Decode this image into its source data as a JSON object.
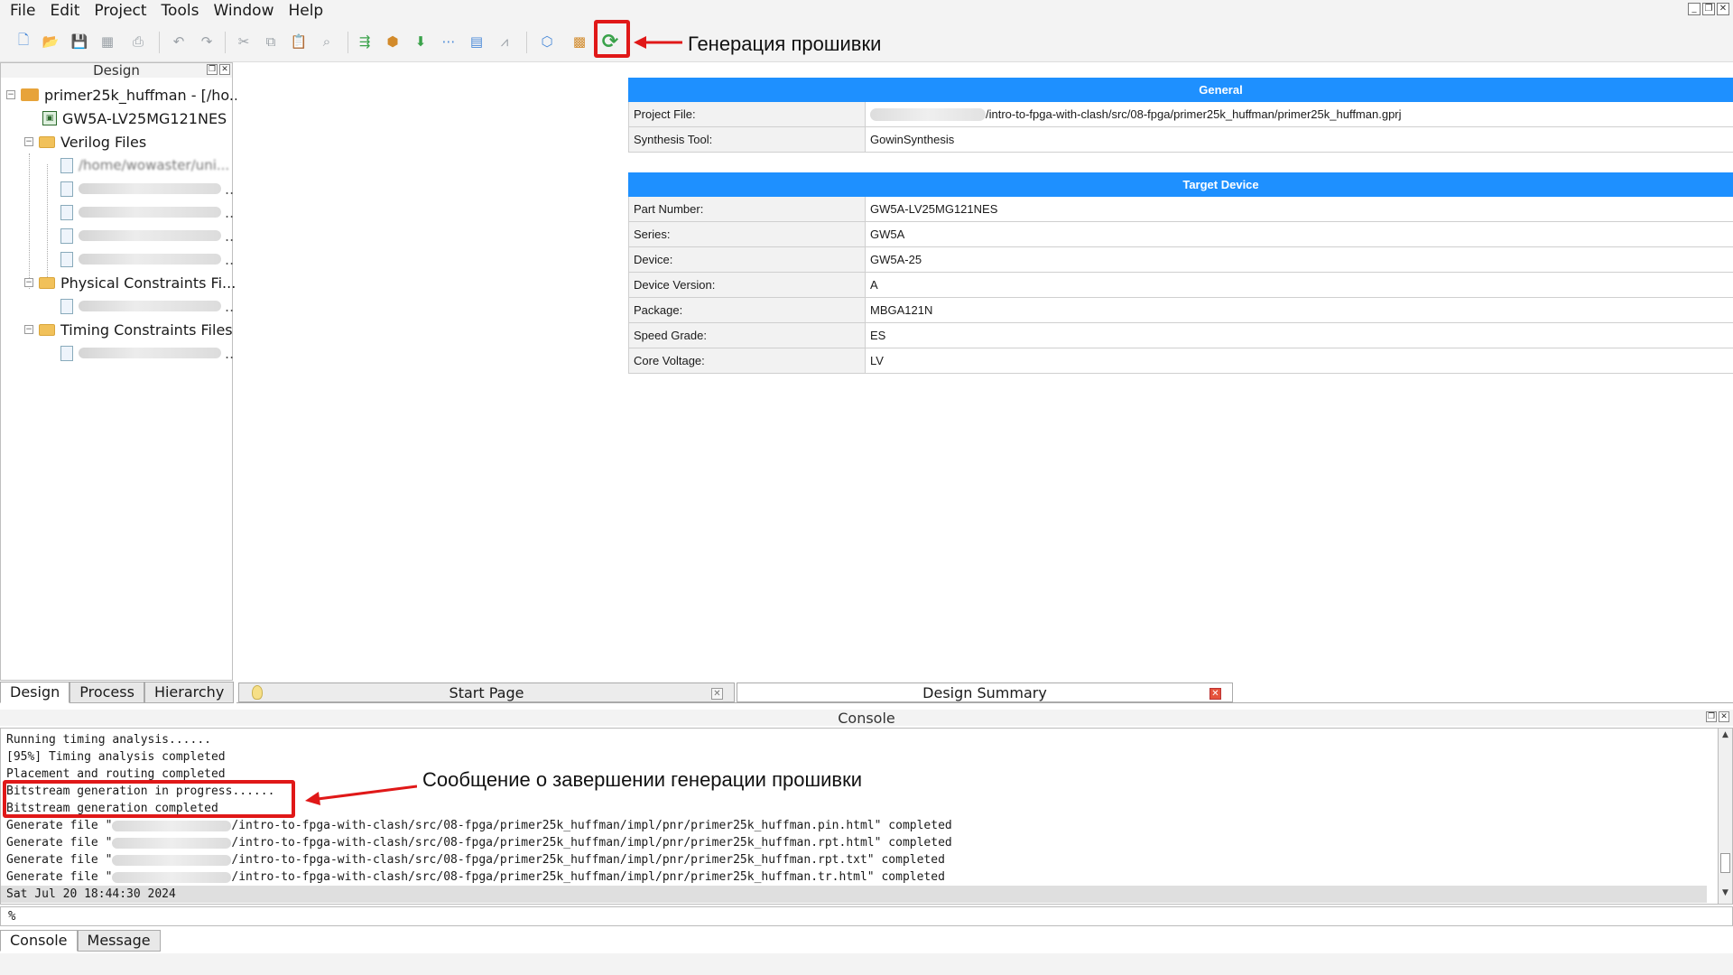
{
  "menu": [
    "File",
    "Edit",
    "Project",
    "Tools",
    "Window",
    "Help"
  ],
  "toolbar": {
    "icons": [
      "new-file-icon",
      "open-folder-icon",
      "save-icon",
      "save-all-icon",
      "print-icon",
      "undo-icon",
      "redo-icon",
      "cut-icon",
      "copy-icon",
      "paste-icon",
      "find-icon",
      "run-synthesis-icon",
      "run-place-route-icon",
      "program-device-icon",
      "floorplanner-icon",
      "timing-analyzer-icon",
      "power-analyzer-icon",
      "ip-core-icon",
      "flow-icon",
      "generate-bitstream-icon"
    ]
  },
  "annotations": {
    "bitstream_button": "Генерация прошивки",
    "console_message": "Сообщение о завершении генерации прошивки"
  },
  "design_panel": {
    "title": "Design",
    "project": "primer25k_huffman - [/ho...",
    "device": "GW5A-LV25MG121NES",
    "verilog_folder": "Verilog Files",
    "verilog_file_first": "/home/wowaster/uni...",
    "physical_folder": "Physical Constraints Fi...",
    "timing_folder": "Timing Constraints Files",
    "tabs": [
      "Design",
      "Process",
      "Hierarchy"
    ]
  },
  "summary": {
    "general_title": "General",
    "project_file_label": "Project File:",
    "project_file_value": "/intro-to-fpga-with-clash/src/08-fpga/primer25k_huffman/primer25k_huffman.gprj",
    "synthesis_tool_label": "Synthesis Tool:",
    "synthesis_tool_value": "GowinSynthesis",
    "target_title": "Target Device",
    "rows": [
      {
        "label": "Part Number:",
        "value": "GW5A-LV25MG121NES"
      },
      {
        "label": "Series:",
        "value": "GW5A"
      },
      {
        "label": "Device:",
        "value": "GW5A-25"
      },
      {
        "label": "Device Version:",
        "value": "A"
      },
      {
        "label": "Package:",
        "value": "MBGA121N"
      },
      {
        "label": "Speed Grade:",
        "value": "ES"
      },
      {
        "label": "Core Voltage:",
        "value": "LV"
      }
    ]
  },
  "doc_tabs": {
    "start_page": "Start Page",
    "design_summary": "Design Summary"
  },
  "console": {
    "title": "Console",
    "lines": [
      "Running timing analysis......",
      "[95%] Timing analysis completed",
      "Placement and routing completed",
      "Bitstream generation in progress......",
      "Bitstream generation completed"
    ],
    "gen_prefix": "Generate file \"",
    "gen_files": [
      "/intro-to-fpga-with-clash/src/08-fpga/primer25k_huffman/impl/pnr/primer25k_huffman.pin.html\" completed",
      "/intro-to-fpga-with-clash/src/08-fpga/primer25k_huffman/impl/pnr/primer25k_huffman.rpt.html\" completed",
      "/intro-to-fpga-with-clash/src/08-fpga/primer25k_huffman/impl/pnr/primer25k_huffman.rpt.txt\" completed",
      "/intro-to-fpga-with-clash/src/08-fpga/primer25k_huffman/impl/pnr/primer25k_huffman.tr.html\" completed"
    ],
    "timestamp": "Sat Jul 20 18:44:30 2024",
    "prompt": "%",
    "tabs": [
      "Console",
      "Message"
    ]
  },
  "colors": {
    "table_header": "#1e90ff",
    "highlight": "#e01818"
  }
}
